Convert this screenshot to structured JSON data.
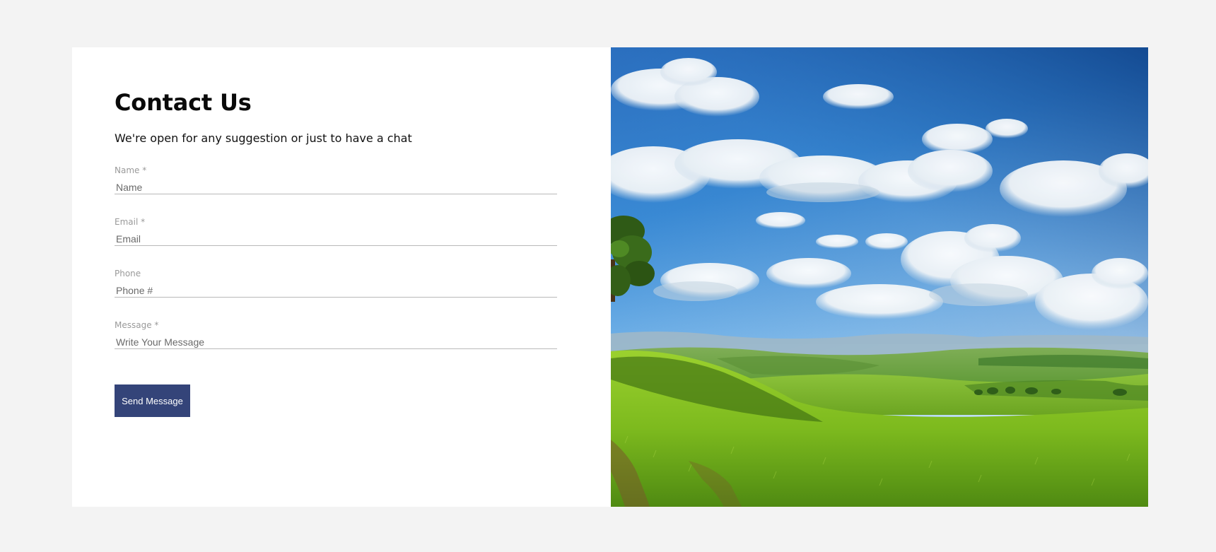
{
  "contact": {
    "title": "Contact Us",
    "subtitle": "We're open for any suggestion or just to have a chat"
  },
  "form": {
    "fields": [
      {
        "label": "Name *",
        "placeholder": "Name"
      },
      {
        "label": "Email *",
        "placeholder": "Email"
      },
      {
        "label": "Phone",
        "placeholder": "Phone #"
      },
      {
        "label": "Message *",
        "placeholder": "Write Your Message"
      }
    ],
    "submit_label": "Send Message"
  },
  "colors": {
    "button": "#344479",
    "background": "#f3f3f3",
    "panel": "#ffffff"
  }
}
